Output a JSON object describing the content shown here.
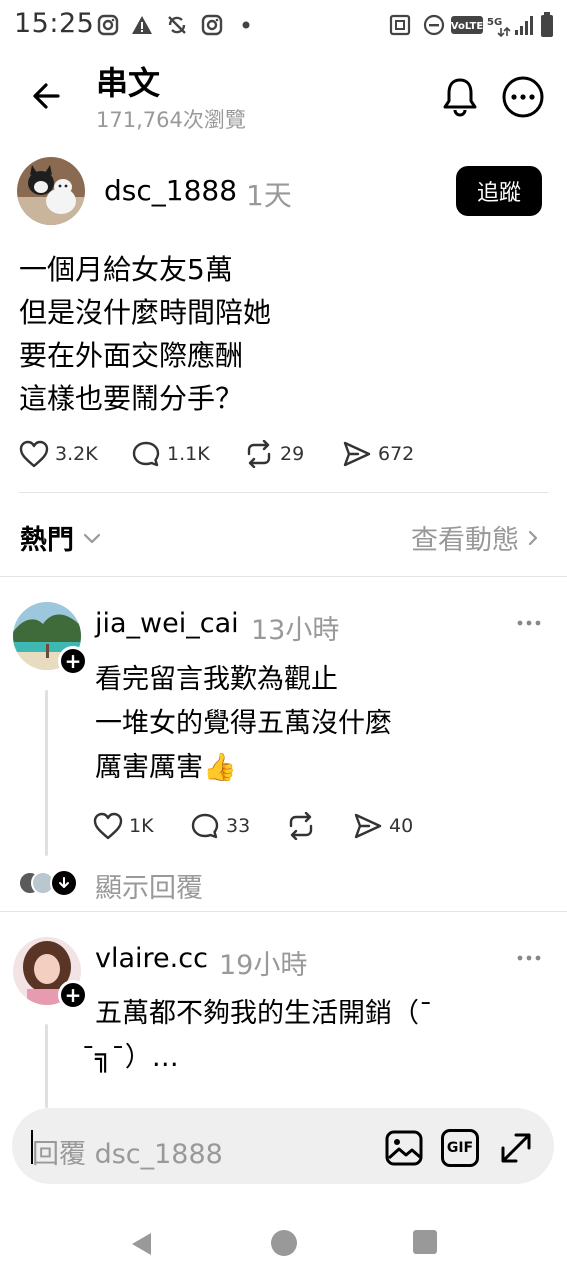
{
  "status_bar": {
    "time": "15:25",
    "left_icons": [
      "instagram-icon",
      "warning-icon",
      "sync-off-icon",
      "instagram-icon",
      "dot-icon"
    ],
    "right_icons": [
      "nfc-icon",
      "do-not-disturb-icon",
      "volte-icon",
      "5g-icon",
      "signal-icon",
      "battery-icon"
    ]
  },
  "header": {
    "title": "串文",
    "views": "171,764次瀏覽"
  },
  "post": {
    "author": "dsc_1888",
    "age": "1天",
    "follow_label": "追蹤",
    "lines": [
      "一個月給女友5萬",
      "但是沒什麼時間陪她",
      "要在外面交際應酬",
      "這樣也要鬧分手？"
    ],
    "likes": "3.2K",
    "comments": "1.1K",
    "reposts": "29",
    "shares": "672"
  },
  "sort_bar": {
    "sort_label": "熱門",
    "activity_label": "查看動態"
  },
  "replies": [
    {
      "author": "jia_wei_cai",
      "age": "13小時",
      "lines": [
        "看完留言我歎為觀止",
        "一堆女的覺得五萬沒什麼",
        "厲害厲害👍"
      ],
      "likes": "1K",
      "comments": "33",
      "shares": "40",
      "show_replies": "顯示回覆"
    },
    {
      "author": "vlaire.cc",
      "age": "19小時",
      "lines": [
        "五萬都不夠我的生活開銷（¯",
        " ̄╗¯）…"
      ]
    }
  ],
  "composer": {
    "placeholder": "回覆 dsc_1888",
    "gif_label": "GIF"
  },
  "colors": {
    "text": "#000000",
    "muted": "#999999",
    "composer_bg": "#efefef",
    "divider": "#e4e4e4"
  }
}
